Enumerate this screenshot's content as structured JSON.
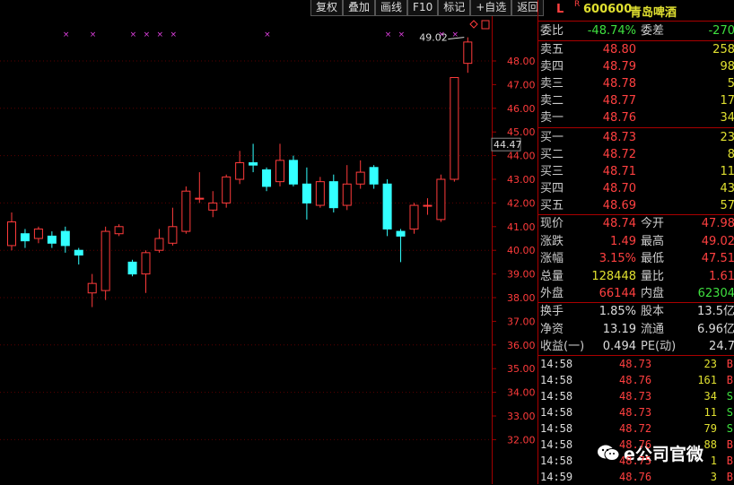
{
  "toolbar": {
    "items": [
      "复权",
      "叠加",
      "画线",
      "F10",
      "标记",
      "+自选",
      "返回"
    ]
  },
  "chart": {
    "price_ticks": [
      "48.00",
      "47.00",
      "46.00",
      "45.00",
      "44.00",
      "43.00",
      "42.00",
      "41.00",
      "40.00",
      "39.00",
      "38.00",
      "37.00",
      "36.00",
      "35.00",
      "34.00",
      "33.00",
      "32.00"
    ],
    "current_price_label": "44.47",
    "high_label": "49.02",
    "candles": [
      {
        "o": 40.2,
        "c": 41.2,
        "h": 41.6,
        "l": 40.0
      },
      {
        "o": 40.7,
        "c": 40.4,
        "h": 40.9,
        "l": 40.1
      },
      {
        "o": 40.5,
        "c": 40.9,
        "h": 41.0,
        "l": 40.3
      },
      {
        "o": 40.6,
        "c": 40.3,
        "h": 40.8,
        "l": 40.1
      },
      {
        "o": 40.8,
        "c": 40.2,
        "h": 41.0,
        "l": 39.9
      },
      {
        "o": 40.0,
        "c": 39.8,
        "h": 40.1,
        "l": 39.4
      },
      {
        "o": 38.2,
        "c": 38.6,
        "h": 39.0,
        "l": 37.6
      },
      {
        "o": 38.3,
        "c": 40.8,
        "h": 41.0,
        "l": 37.9
      },
      {
        "o": 40.7,
        "c": 41.0,
        "h": 41.1,
        "l": 40.6
      },
      {
        "o": 39.5,
        "c": 39.0,
        "h": 39.6,
        "l": 38.9
      },
      {
        "o": 39.0,
        "c": 39.9,
        "h": 40.0,
        "l": 38.2
      },
      {
        "o": 40.0,
        "c": 40.5,
        "h": 40.9,
        "l": 39.9
      },
      {
        "o": 40.3,
        "c": 41.0,
        "h": 41.8,
        "l": 40.2
      },
      {
        "o": 40.8,
        "c": 42.5,
        "h": 42.7,
        "l": 40.7
      },
      {
        "o": 42.2,
        "c": 42.2,
        "h": 43.3,
        "l": 42.0
      },
      {
        "o": 41.7,
        "c": 42.0,
        "h": 42.5,
        "l": 41.4
      },
      {
        "o": 42.0,
        "c": 43.1,
        "h": 43.2,
        "l": 41.8
      },
      {
        "o": 43.0,
        "c": 43.7,
        "h": 44.2,
        "l": 42.8
      },
      {
        "o": 43.7,
        "c": 43.6,
        "h": 44.5,
        "l": 43.3
      },
      {
        "o": 43.4,
        "c": 42.7,
        "h": 43.5,
        "l": 42.5
      },
      {
        "o": 42.9,
        "c": 43.8,
        "h": 44.5,
        "l": 42.7
      },
      {
        "o": 43.8,
        "c": 42.8,
        "h": 44.0,
        "l": 42.7
      },
      {
        "o": 42.8,
        "c": 42.0,
        "h": 43.5,
        "l": 41.3
      },
      {
        "o": 41.9,
        "c": 42.9,
        "h": 43.1,
        "l": 41.8
      },
      {
        "o": 42.9,
        "c": 41.8,
        "h": 43.2,
        "l": 41.6
      },
      {
        "o": 41.9,
        "c": 42.8,
        "h": 43.6,
        "l": 41.7
      },
      {
        "o": 42.8,
        "c": 43.3,
        "h": 43.8,
        "l": 42.6
      },
      {
        "o": 43.5,
        "c": 42.8,
        "h": 43.6,
        "l": 42.6
      },
      {
        "o": 42.8,
        "c": 40.9,
        "h": 43.0,
        "l": 40.6
      },
      {
        "o": 40.8,
        "c": 40.6,
        "h": 40.9,
        "l": 39.5
      },
      {
        "o": 40.9,
        "c": 41.9,
        "h": 42.0,
        "l": 40.7
      },
      {
        "o": 41.9,
        "c": 41.9,
        "h": 42.2,
        "l": 41.5
      },
      {
        "o": 41.3,
        "c": 43.0,
        "h": 43.2,
        "l": 41.2
      },
      {
        "o": 43.0,
        "c": 47.3,
        "h": 47.3,
        "l": 42.9
      },
      {
        "o": 47.9,
        "c": 48.8,
        "h": 49.0,
        "l": 47.5
      }
    ],
    "markers": [
      2,
      4,
      7,
      8,
      9,
      10,
      17,
      26,
      27,
      30,
      31
    ]
  },
  "panel": {
    "flag": "L",
    "flag_sup": "R",
    "code": "600600",
    "name": "青岛啤酒",
    "ratio_label": "委比",
    "ratio_value": "-48.74%",
    "diff_label": "委差",
    "diff_value": "-270",
    "asks": [
      {
        "label": "卖五",
        "price": "48.80",
        "vol": "258"
      },
      {
        "label": "卖四",
        "price": "48.79",
        "vol": "98"
      },
      {
        "label": "卖三",
        "price": "48.78",
        "vol": "5"
      },
      {
        "label": "卖二",
        "price": "48.77",
        "vol": "17"
      },
      {
        "label": "卖一",
        "price": "48.76",
        "vol": "34"
      }
    ],
    "bids": [
      {
        "label": "买一",
        "price": "48.73",
        "vol": "23"
      },
      {
        "label": "买二",
        "price": "48.72",
        "vol": "8"
      },
      {
        "label": "买三",
        "price": "48.71",
        "vol": "11"
      },
      {
        "label": "买四",
        "price": "48.70",
        "vol": "43"
      },
      {
        "label": "买五",
        "price": "48.69",
        "vol": "57"
      }
    ],
    "stats": [
      {
        "l1": "现价",
        "v1": "48.74",
        "c1": "red",
        "l2": "今开",
        "v2": "47.98",
        "c2": "red"
      },
      {
        "l1": "涨跌",
        "v1": "1.49",
        "c1": "red",
        "l2": "最高",
        "v2": "49.02",
        "c2": "red"
      },
      {
        "l1": "涨幅",
        "v1": "3.15%",
        "c1": "red",
        "l2": "最低",
        "v2": "47.51",
        "c2": "red"
      },
      {
        "l1": "总量",
        "v1": "128448",
        "c1": "yellow",
        "l2": "量比",
        "v2": "1.61",
        "c2": "red"
      },
      {
        "l1": "外盘",
        "v1": "66144",
        "c1": "red",
        "l2": "内盘",
        "v2": "62304",
        "c2": "green"
      }
    ],
    "stats2": [
      {
        "l1": "换手",
        "v1": "1.85%",
        "l2": "股本",
        "v2": "13.5亿"
      },
      {
        "l1": "净资",
        "v1": "13.19",
        "l2": "流通",
        "v2": "6.96亿"
      },
      {
        "l1": "收益(一)",
        "v1": "0.494",
        "l2": "PE(动)",
        "v2": "24.7"
      }
    ],
    "ticks": [
      {
        "time": "14:58",
        "price": "48.73",
        "vol": "23",
        "side": "B"
      },
      {
        "time": "14:58",
        "price": "48.76",
        "vol": "161",
        "side": "B"
      },
      {
        "time": "14:58",
        "price": "48.73",
        "vol": "34",
        "side": "S"
      },
      {
        "time": "14:58",
        "price": "48.73",
        "vol": "11",
        "side": "S"
      },
      {
        "time": "14:58",
        "price": "48.72",
        "vol": "79",
        "side": "S"
      },
      {
        "time": "14:58",
        "price": "48.76",
        "vol": "88",
        "side": "B"
      },
      {
        "time": "14:58",
        "price": "48.75",
        "vol": "1",
        "side": "B"
      },
      {
        "time": "14:59",
        "price": "48.76",
        "vol": "3",
        "side": "B"
      }
    ]
  },
  "watermark": {
    "text": "e公司官微"
  },
  "colors": {
    "up": "#ff3b3b",
    "down": "#33ffff",
    "accent": "#a00000",
    "vol": "#e0e030"
  }
}
